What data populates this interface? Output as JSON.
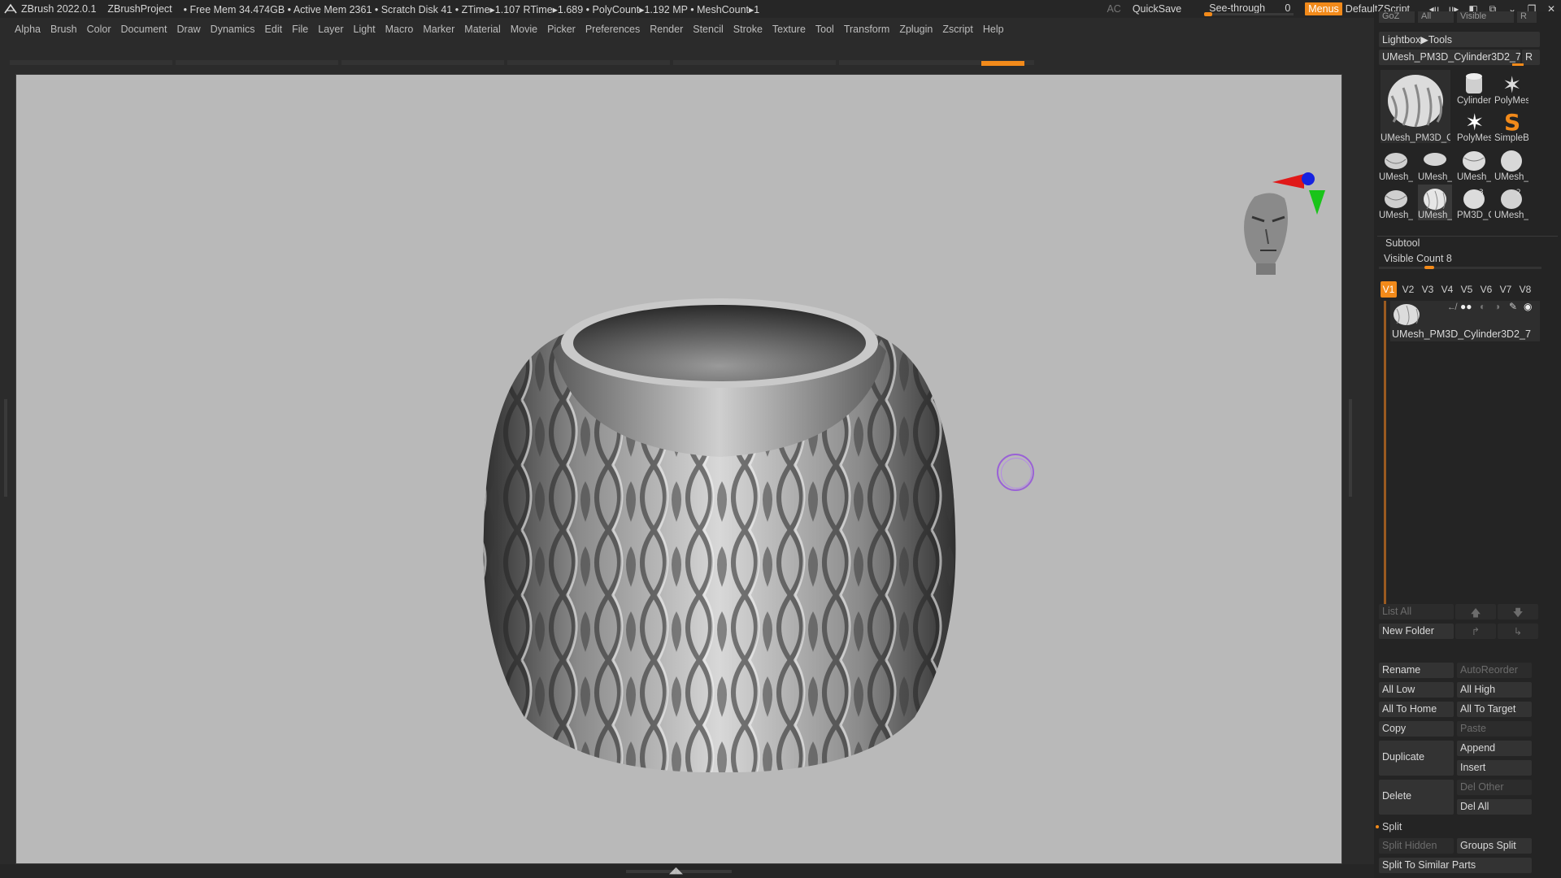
{
  "titlebar": {
    "app": "ZBrush 2022.0.1",
    "project": "ZBrushProject",
    "stats": "• Free Mem 34.474GB • Active Mem 2361 • Scratch Disk 41 • ZTime▸1.107 RTime▸1.689 • PolyCount▸1.192 MP • MeshCount▸1",
    "ac": "AC",
    "quicksave": "QuickSave",
    "seethrough_label": "See-through",
    "seethrough_value": "0",
    "menus": "Menus",
    "script": "DefaultZScript"
  },
  "menu": [
    "Alpha",
    "Brush",
    "Color",
    "Document",
    "Draw",
    "Dynamics",
    "Edit",
    "File",
    "Layer",
    "Light",
    "Macro",
    "Marker",
    "Material",
    "Movie",
    "Picker",
    "Preferences",
    "Render",
    "Stencil",
    "Stroke",
    "Texture",
    "Tool",
    "Transform",
    "Zplugin",
    "Zscript",
    "Help"
  ],
  "panel": {
    "top_clip": [
      "GoZ",
      "All",
      "Visible",
      "R"
    ],
    "lightbox": "Lightbox▶Tools",
    "current_tool": "UMesh_PM3D_Cylinder3D2_7",
    "current_tool_r": "R",
    "main_thumb_label": "UMesh_PM3D_C",
    "thumbs_right": [
      "Cylinder",
      "PolyMes",
      "PolyMes",
      "SimpleB"
    ],
    "thumbs_grid": [
      "UMesh_",
      "UMesh_",
      "UMesh_",
      "UMesh_",
      "UMesh_",
      "UMesh_",
      "PM3D_C",
      "UMesh_"
    ],
    "thumb_badges": [
      "",
      "",
      "",
      "",
      "",
      "",
      "3",
      "2"
    ],
    "subtool_title": "Subtool",
    "visible_count": "Visible Count 8",
    "vtabs": [
      "V1",
      "V2",
      "V3",
      "V4",
      "V5",
      "V6",
      "V7",
      "V8"
    ],
    "subtool_item": "UMesh_PM3D_Cylinder3D2_7",
    "list_all": "List All",
    "new_folder": "New Folder",
    "buttons": {
      "rename": "Rename",
      "autoreorder": "AutoReorder",
      "all_low": "All Low",
      "all_high": "All High",
      "all_to_home": "All To Home",
      "all_to_target": "All To Target",
      "copy": "Copy",
      "paste": "Paste",
      "duplicate": "Duplicate",
      "append": "Append",
      "insert": "Insert",
      "delete": "Delete",
      "del_other": "Del Other",
      "del_all": "Del All",
      "split": "Split",
      "split_hidden": "Split Hidden",
      "groups_split": "Groups Split",
      "split_similar": "Split To Similar Parts"
    }
  },
  "colors": {
    "accent": "#f28a1a",
    "brush": "#9a62d6",
    "viewport": "#b9b9b9"
  }
}
